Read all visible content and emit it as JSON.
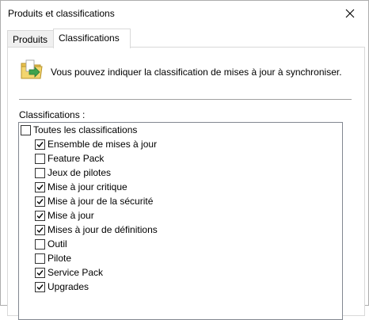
{
  "window": {
    "title": "Produits et classifications"
  },
  "tabs": [
    {
      "label": "Produits",
      "active": false
    },
    {
      "label": "Classifications",
      "active": true
    }
  ],
  "banner": {
    "icon": "folder-sync-icon",
    "text": "Vous pouvez indiquer la classification de mises à jour à synchroniser."
  },
  "section": {
    "label": "Classifications :"
  },
  "tree": {
    "root": {
      "label": "Toutes les classifications",
      "checked": false
    },
    "items": [
      {
        "label": "Ensemble de mises à jour",
        "checked": true
      },
      {
        "label": "Feature Pack",
        "checked": false
      },
      {
        "label": "Jeux de pilotes",
        "checked": false
      },
      {
        "label": "Mise à jour critique",
        "checked": true
      },
      {
        "label": "Mise à jour de la sécurité",
        "checked": true
      },
      {
        "label": "Mise à jour",
        "checked": true
      },
      {
        "label": "Mises à jour de définitions",
        "checked": true
      },
      {
        "label": "Outil",
        "checked": false
      },
      {
        "label": "Pilote",
        "checked": false
      },
      {
        "label": "Service Pack",
        "checked": true
      },
      {
        "label": "Upgrades",
        "checked": true
      }
    ]
  },
  "colors": {
    "accent": "#0078d7",
    "folder": "#e8c14f",
    "arrow": "#3fa34d"
  }
}
